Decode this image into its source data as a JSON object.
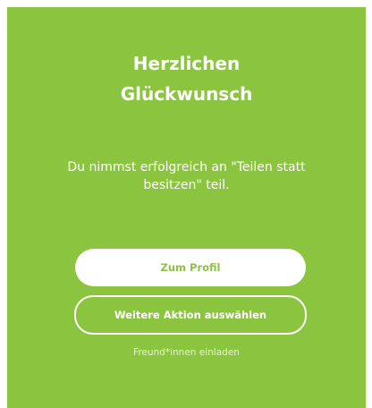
{
  "dialog": {
    "title_line1": "Herzlichen",
    "title_line2": "Glückwunsch",
    "message": "Du nimmst erfolgreich an \"Teilen statt besitzen\" teil.",
    "primary_button_label": "Zum Profil",
    "secondary_button_label": "Weitere Aktion auswählen",
    "invite_link_label": "Freund*innen einladen"
  },
  "colors": {
    "accent_green": "#8bc53f",
    "text_white": "#ffffff"
  }
}
